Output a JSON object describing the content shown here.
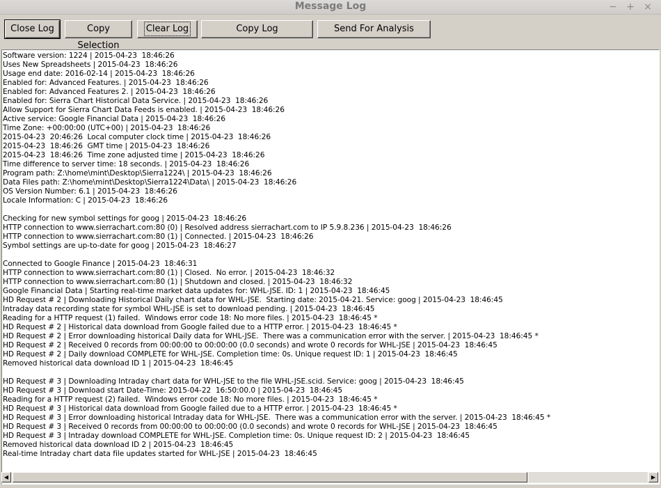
{
  "window": {
    "title": "Message Log",
    "minimize_glyph": "−",
    "maximize_glyph": "+",
    "close_glyph": "×"
  },
  "toolbar": {
    "close_log_label": "Close Log",
    "copy_selection_label": "Copy Selection",
    "clear_log_label": "Clear Log",
    "copy_log_label": "Copy Log",
    "send_for_analysis_label": "Send For Analysis"
  },
  "log": {
    "lines": [
      "Software version: 1224 | 2015-04-23  18:46:26",
      "Uses New Spreadsheets | 2015-04-23  18:46:26",
      "Usage end date: 2016-02-14 | 2015-04-23  18:46:26",
      "Enabled for: Advanced Features. | 2015-04-23  18:46:26",
      "Enabled for: Advanced Features 2. | 2015-04-23  18:46:26",
      "Enabled for: Sierra Chart Historical Data Service. | 2015-04-23  18:46:26",
      "Allow Support for Sierra Chart Data Feeds is enabled. | 2015-04-23  18:46:26",
      "Active service: Google Financial Data | 2015-04-23  18:46:26",
      "Time Zone: +00:00:00 (UTC+00) | 2015-04-23  18:46:26",
      "2015-04-23  20:46:26  Local computer clock time | 2015-04-23  18:46:26",
      "2015-04-23  18:46:26  GMT time | 2015-04-23  18:46:26",
      "2015-04-23  18:46:26  Time zone adjusted time | 2015-04-23  18:46:26",
      "Time difference to server time: 18 seconds. | 2015-04-23  18:46:26",
      "Program path: Z:\\home\\mint\\Desktop\\Sierra1224\\ | 2015-04-23  18:46:26",
      "Data Files path: Z:\\home\\mint\\Desktop\\Sierra1224\\Data\\ | 2015-04-23  18:46:26",
      "OS Version Number: 6.1 | 2015-04-23  18:46:26",
      "Locale Information: C | 2015-04-23  18:46:26",
      "",
      "Checking for new symbol settings for goog | 2015-04-23  18:46:26",
      "HTTP connection to www.sierrachart.com:80 (0) | Resolved address sierrachart.com to IP 5.9.8.236 | 2015-04-23  18:46:26",
      "HTTP connection to www.sierrachart.com:80 (1) | Connected. | 2015-04-23  18:46:26",
      "Symbol settings are up-to-date for goog | 2015-04-23  18:46:27",
      "",
      "Connected to Google Finance | 2015-04-23  18:46:31",
      "HTTP connection to www.sierrachart.com:80 (1) | Closed.  No error. | 2015-04-23  18:46:32",
      "HTTP connection to www.sierrachart.com:80 (1) | Shutdown and closed. | 2015-04-23  18:46:32",
      "Google Financial Data | Starting real-time market data updates for: WHL-JSE. ID: 1 | 2015-04-23  18:46:45",
      "HD Request # 2 | Downloading Historical Daily chart data for WHL-JSE.  Starting date: 2015-04-21. Service: goog | 2015-04-23  18:46:45",
      "Intraday data recording state for symbol WHL-JSE is set to download pending. | 2015-04-23  18:46:45",
      "Reading for a HTTP request (1) failed.  Windows error code 18: No more files. | 2015-04-23  18:46:45 *",
      "HD Request # 2 | Historical data download from Google failed due to a HTTP error. | 2015-04-23  18:46:45 *",
      "HD Request # 2 | Error downloading historical Daily data for WHL-JSE.  There was a communication error with the server. | 2015-04-23  18:46:45 *",
      "HD Request # 2 | Received 0 records from 00:00:00 to 00:00:00 (0.0 seconds) and wrote 0 records for WHL-JSE | 2015-04-23  18:46:45",
      "HD Request # 2 | Daily download COMPLETE for WHL-JSE. Completion time: 0s. Unique request ID: 1 | 2015-04-23  18:46:45",
      "Removed historical data download ID 1 | 2015-04-23  18:46:45",
      "",
      "HD Request # 3 | Downloading Intraday chart data for WHL-JSE to the file WHL-JSE.scid. Service: goog | 2015-04-23  18:46:45",
      "HD Request # 3 | Download start Date-Time: 2015-04-22  16:50:00.0 | 2015-04-23  18:46:45",
      "Reading for a HTTP request (2) failed.  Windows error code 18: No more files. | 2015-04-23  18:46:45 *",
      "HD Request # 3 | Historical data download from Google failed due to a HTTP error. | 2015-04-23  18:46:45 *",
      "HD Request # 3 | Error downloading historical Intraday data for WHL-JSE.  There was a communication error with the server. | 2015-04-23  18:46:45 *",
      "HD Request # 3 | Received 0 records from 00:00:00 to 00:00:00 (0.0 seconds) and wrote 0 records for WHL-JSE | 2015-04-23  18:46:45",
      "HD Request # 3 | Intraday download COMPLETE for WHL-JSE. Completion time: 0s. Unique request ID: 2 | 2015-04-23  18:46:45",
      "Removed historical data download ID 2 | 2015-04-23  18:46:45",
      "Real-time Intraday chart data file updates started for WHL-JSE | 2015-04-23  18:46:45"
    ]
  },
  "scrollbar": {
    "left_arrow_glyph": "◀",
    "right_arrow_glyph": "▶"
  }
}
